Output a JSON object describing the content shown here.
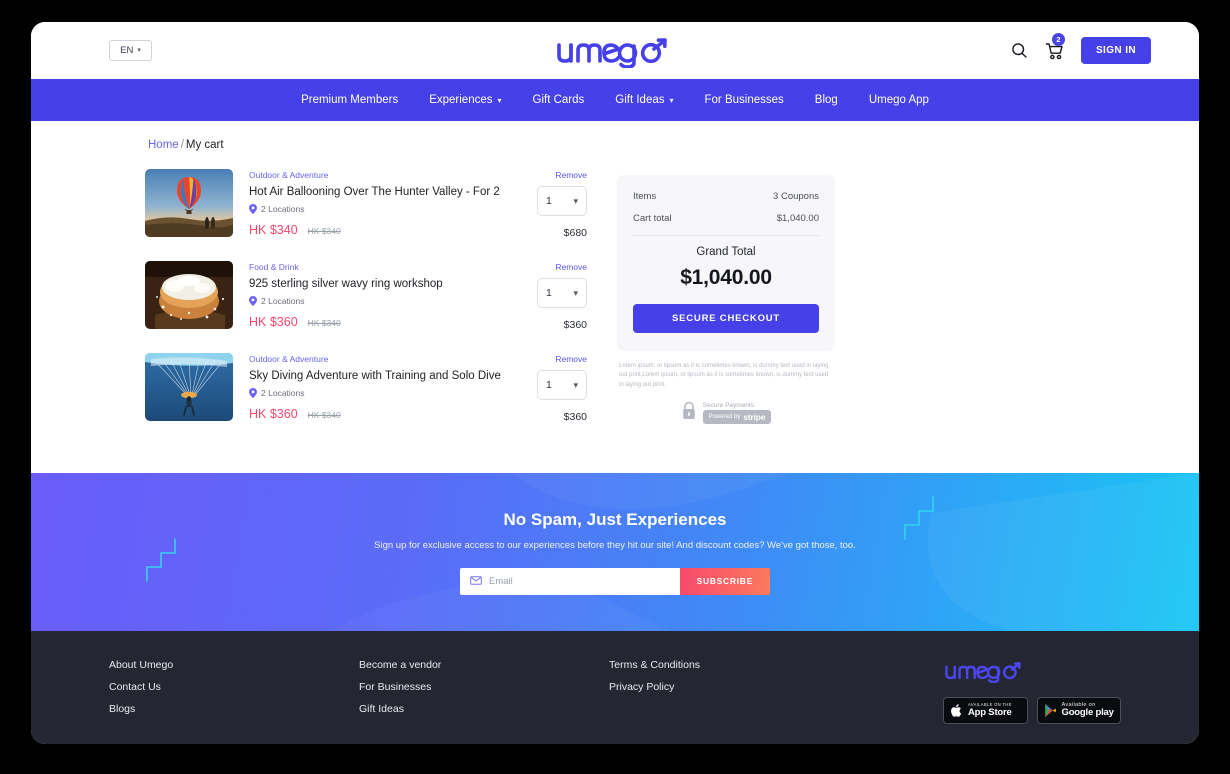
{
  "topbar": {
    "language": "EN",
    "language_chevron": "chevron-down-icon",
    "brand": "umego",
    "search_icon": "search-icon",
    "cart_icon": "cart-icon",
    "cart_count": "2",
    "signin_label": "SIGN IN"
  },
  "nav": {
    "items": [
      {
        "label": "Premium Members",
        "has_chevron": false
      },
      {
        "label": "Experiences",
        "has_chevron": true
      },
      {
        "label": "Gift Cards",
        "has_chevron": false
      },
      {
        "label": "Gift Ideas",
        "has_chevron": true
      },
      {
        "label": "For Businesses",
        "has_chevron": false
      },
      {
        "label": "Blog",
        "has_chevron": false
      },
      {
        "label": "Umego App",
        "has_chevron": false
      }
    ]
  },
  "breadcrumb": {
    "home": "Home",
    "separator": "/",
    "current": "My cart"
  },
  "cart": {
    "remove_label": "Remove",
    "items": [
      {
        "category": "Outdoor & Adventure",
        "title": "Hot Air Ballooning Over The Hunter Valley - For 2",
        "locations": "2 Locations",
        "price_now": "HK $340",
        "price_was": "HK $340",
        "quantity": "1",
        "line_total": "$680",
        "image": "hot-air-balloon-photo"
      },
      {
        "category": "Food & Drink",
        "title": "925 sterling silver wavy ring workshop",
        "locations": "2 Locations",
        "price_now": "HK $360",
        "price_was": "HK $340",
        "quantity": "1",
        "line_total": "$360",
        "image": "dessert-photo"
      },
      {
        "category": "Outdoor & Adventure",
        "title": "Sky Diving Adventure with Training and Solo Dive",
        "locations": "2 Locations",
        "price_now": "HK $360",
        "price_was": "HK $340",
        "quantity": "1",
        "line_total": "$360",
        "image": "sky-diving-photo"
      }
    ]
  },
  "summary": {
    "items_label": "Items",
    "items_value": "3 Coupons",
    "cart_total_label": "Cart total",
    "cart_total_value": "$1,040.00",
    "grand_total_label": "Grand Total",
    "grand_total_value": "$1,040.00",
    "checkout_label": "SECURE CHECKOUT",
    "legal_text": "Lorem ipsum, or lipsum as it is sometimes known, is dummy text used in laying out print,Lorem ipsum, or lipsum as it is sometimes known, is dummy text used in laying out print.",
    "secure_payments_label": "Secure Payments",
    "stripe_powered_by": "Powered by",
    "stripe_name": "stripe",
    "lock_icon": "lock-icon"
  },
  "newsletter": {
    "title": "No Spam, Just Experiences",
    "subtitle": "Sign up for exclusive access to our experiences before they hit our site! And discount codes? We've got those, too.",
    "email_placeholder": "Email",
    "email_value": "",
    "email_icon": "envelope-icon",
    "subscribe_label": "SUBSCRIBE"
  },
  "footer": {
    "col1": [
      "About Umego",
      "Contact Us",
      "Blogs"
    ],
    "col2": [
      "Become a vendor",
      "For Businesses",
      "Gift Ideas"
    ],
    "col3": [
      "Terms & Conditions",
      "Privacy Policy"
    ],
    "brand": "umego",
    "stores": [
      {
        "top": "AVAILABLE ON THE",
        "name": "App Store",
        "icon": "apple-icon"
      },
      {
        "top": "Available on",
        "name": "Google play",
        "icon": "google-play-icon"
      }
    ]
  },
  "colors": {
    "brand_indigo": "#4540e8",
    "accent_pink": "#f8496c",
    "link_purple": "#6a63f0",
    "footer_dark": "#242632"
  }
}
